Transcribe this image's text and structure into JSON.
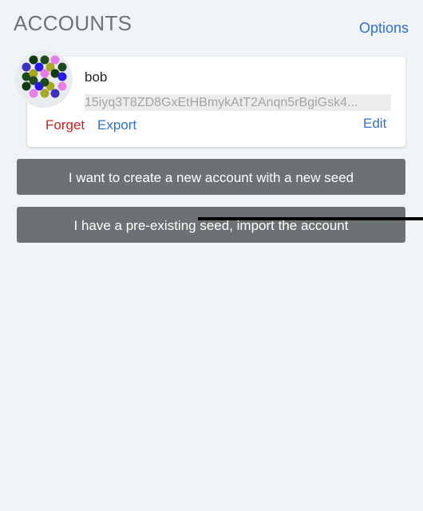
{
  "header": {
    "title": "ACCOUNTS",
    "options_label": "Options"
  },
  "account": {
    "name": "bob",
    "address": "15iyq3T8ZD8GxEtHBmykAtT2Anqn5rBgiGsk4...",
    "forget_label": "Forget",
    "export_label": "Export",
    "edit_label": "Edit",
    "avatar_icon": "identicon-avatar",
    "avatar_colors": [
      "#3b2fbf",
      "#a6a81e",
      "#1f4a1f",
      "#2a17f0",
      "#e87de8",
      "#0f3b0f"
    ]
  },
  "actions": {
    "create_label": "I want to create a new account with a new seed",
    "import_label": "I have a pre-existing seed, import the account"
  },
  "colors": {
    "background": "#f0f4f6",
    "link": "#2f6fd1",
    "danger": "#cc1f1a",
    "button": "#6c7173"
  }
}
